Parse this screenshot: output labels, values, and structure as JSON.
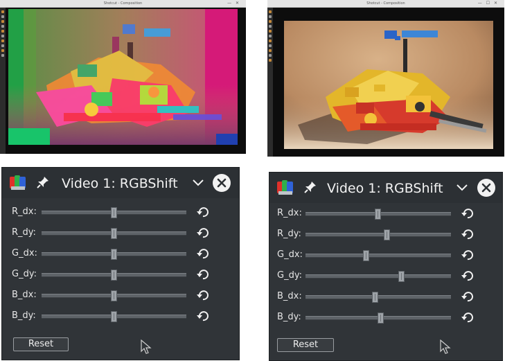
{
  "left_screenshot": {
    "window_title": "Shotcut - Composition",
    "window_controls": "— ✕"
  },
  "right_screenshot": {
    "window_title": "Shotcut - Composition",
    "window_controls": "— ☐ ✕"
  },
  "left_panel": {
    "title": "Video 1: RGBShift",
    "icons": {
      "app": "color-palette-icon",
      "pin": "pin-icon",
      "menu": "chevron-down-icon",
      "close": "close-icon",
      "row_reset": "undo-icon",
      "cursor": "mouse-pointer-icon"
    },
    "sliders": [
      {
        "label": "R_dx:",
        "value": 0.5
      },
      {
        "label": "R_dy:",
        "value": 0.5
      },
      {
        "label": "G_dx:",
        "value": 0.5
      },
      {
        "label": "G_dy:",
        "value": 0.5
      },
      {
        "label": "B_dx:",
        "value": 0.5
      },
      {
        "label": "B_dy:",
        "value": 0.5
      }
    ],
    "reset_label": "Reset"
  },
  "right_panel": {
    "title": "Video 1: RGBShift",
    "icons": {
      "app": "color-palette-icon",
      "pin": "pin-icon",
      "menu": "chevron-down-icon",
      "close": "close-icon",
      "row_reset": "undo-icon",
      "cursor": "mouse-pointer-icon"
    },
    "sliders": [
      {
        "label": "R_dx:",
        "value": 0.5
      },
      {
        "label": "R_dy:",
        "value": 0.56
      },
      {
        "label": "G_dx:",
        "value": 0.42
      },
      {
        "label": "G_dy:",
        "value": 0.66
      },
      {
        "label": "B_dx:",
        "value": 0.48
      },
      {
        "label": "B_dy:",
        "value": 0.52
      }
    ],
    "reset_label": "Reset"
  },
  "colors": {
    "panel_bg": "#303438",
    "panel_header": "#2c3034",
    "text": "#f2f2f2",
    "slider_track": "#5e6368",
    "slider_thumb": "#9ea3a8"
  }
}
